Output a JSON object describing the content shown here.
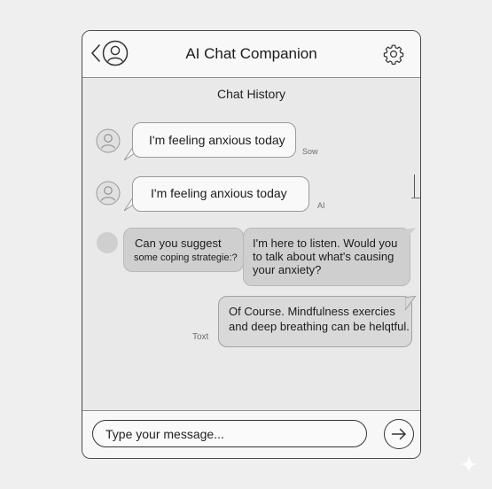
{
  "header": {
    "title": "AI Chat Companion",
    "back_icon": "chevron-left-icon",
    "avatar_icon": "user-avatar-icon",
    "settings_icon": "gear-icon"
  },
  "chat": {
    "section_label": "Chat History",
    "messages": [
      {
        "text": "I'm feeling anxious today",
        "meta": "Sow"
      },
      {
        "text": "I'm feeling anxious today",
        "meta": "AI"
      },
      {
        "line1": "Can you suggest",
        "line2": "some coping strategie:?"
      },
      {
        "line1": "I'm here to listen. Would you",
        "line2": "to talk about what's causing",
        "line3": "your anxiety?"
      },
      {
        "line1": "Of Course. Mindfulness exercies",
        "line2": "and deep breathing can be helqtful.",
        "meta": "Toxt"
      }
    ]
  },
  "composer": {
    "placeholder": "Type your message...",
    "send_icon": "arrow-right-icon"
  },
  "colors": {
    "background": "#efefef",
    "panel": "#e9e9e9",
    "bubble_white": "#f9f9f9",
    "bubble_gray": "#cfcfcf",
    "stroke": "#333333"
  }
}
